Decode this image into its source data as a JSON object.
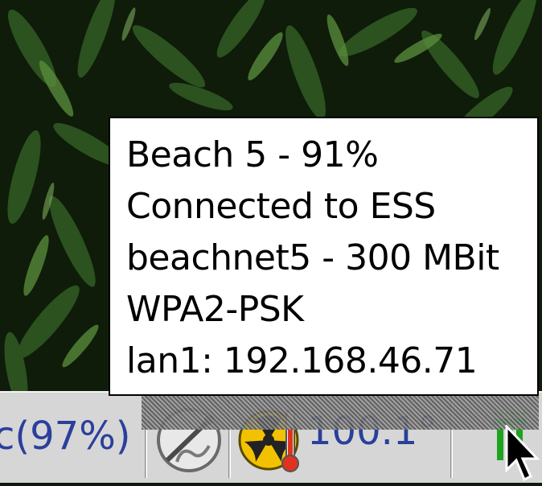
{
  "tooltip": {
    "lines": [
      "Beach 5 - 91%",
      "Connected to ESS",
      "beachnet5 - 300 MBit",
      "WPA2-PSK",
      "lan1: 192.168.46.71"
    ]
  },
  "taskbar": {
    "battery_text": "c(97%)",
    "temperature_text": "100.1°",
    "icons": [
      "usb-drive-icon",
      "radiation-thermometer-icon",
      "wifi-signal-icon",
      "mouse-pointer-icon"
    ]
  },
  "colors": {
    "taskbar_bg": "#d6d6d6",
    "status_text": "#2b3f9c",
    "tooltip_bg": "#ffffff",
    "wifi_bars": "#22dd22"
  }
}
